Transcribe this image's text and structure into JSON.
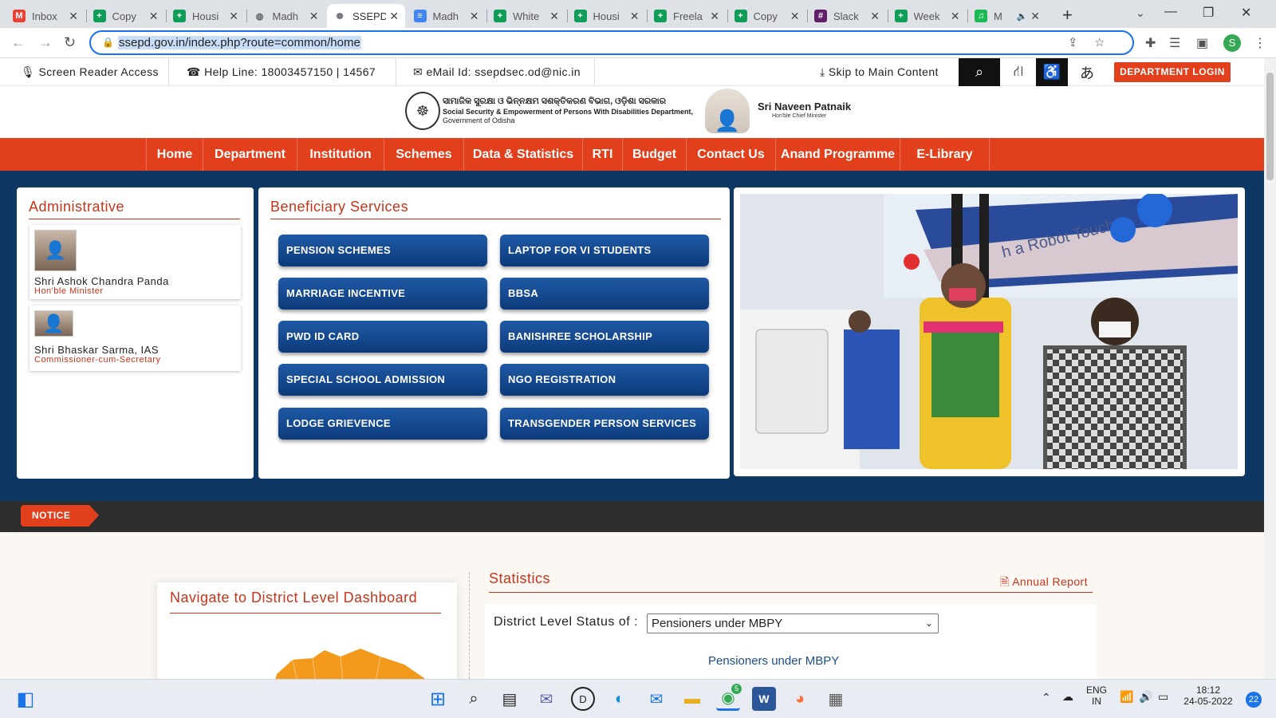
{
  "browser": {
    "tabs": [
      {
        "label": "Inbox",
        "icon": "gmail-icon",
        "color": "#ea4335",
        "glyph": "M"
      },
      {
        "label": "Copy",
        "icon": "sheets-icon",
        "color": "#0f9d58",
        "glyph": "+"
      },
      {
        "label": "Housi",
        "icon": "sheets-icon",
        "color": "#0f9d58",
        "glyph": "+"
      },
      {
        "label": "Madh",
        "icon": "globe-icon",
        "color": "#5f6368",
        "glyph": "◍"
      },
      {
        "label": "SSEPD",
        "icon": "odisha-emblem-icon",
        "color": "#5f6368",
        "glyph": "☸"
      },
      {
        "label": "Madh",
        "icon": "docs-icon",
        "color": "#4285f4",
        "glyph": "≡"
      },
      {
        "label": "White",
        "icon": "sheets-icon",
        "color": "#0f9d58",
        "glyph": "+"
      },
      {
        "label": "Housi",
        "icon": "sheets-icon",
        "color": "#0f9d58",
        "glyph": "+"
      },
      {
        "label": "Freela",
        "icon": "sheets-icon",
        "color": "#0f9d58",
        "glyph": "+"
      },
      {
        "label": "Copy",
        "icon": "sheets-icon",
        "color": "#0f9d58",
        "glyph": "+"
      },
      {
        "label": "Slack",
        "icon": "slack-icon",
        "color": "#611f69",
        "glyph": "#"
      },
      {
        "label": "Week",
        "icon": "sheets-icon",
        "color": "#0f9d58",
        "glyph": "+"
      },
      {
        "label": "M",
        "icon": "spotify-icon",
        "color": "#1db954",
        "glyph": "♫"
      }
    ],
    "active_tab": 4,
    "url": "ssepd.gov.in/index.php?route=common/home",
    "profile_initial": "S"
  },
  "util": {
    "screen_reader": "Screen Reader Access",
    "helpline": "Help Line: 18003457150 | 14567",
    "email": "eMail Id: ssepdsec.od@nic.in",
    "skip": "Skip to Main Content",
    "dept_login": "DEPARTMENT LOGIN"
  },
  "header": {
    "odia_title": "ସାମାଜିକ ସୁରକ୍ଷା ଓ ଭିନ୍ନକ୍ଷମ ସଶକ୍ତିକରଣ ବିଭାଗ, ଓଡ଼ିଶା ସରକାର",
    "dept_title": "Social Security & Empowerment of Persons With Disabilities Department,",
    "dept_sub": "Government of Odisha",
    "cm_name": "Sri Naveen Patnaik",
    "cm_role": "Hon'ble Chief Minister"
  },
  "nav": [
    "Home",
    "Department",
    "Institution",
    "Schemes",
    "Data & Statistics",
    "RTI",
    "Budget",
    "Contact Us",
    "Anand Programme",
    "E-Library"
  ],
  "administrative": {
    "title": "Administrative",
    "people": [
      {
        "name": "Shri Ashok Chandra Panda",
        "role": "Hon'ble Minister"
      },
      {
        "name": "Shri Bhaskar Sarma, IAS",
        "role": "Commissioner-cum-Secretary"
      }
    ]
  },
  "beneficiary": {
    "title": "Beneficiary Services",
    "left": [
      "PENSION SCHEMES",
      "MARRIAGE INCENTIVE",
      "PWD ID CARD",
      "SPECIAL SCHOOL ADMISSION",
      "LODGE GRIEVENCE"
    ],
    "right": [
      "LAPTOP FOR VI STUDENTS",
      "BBSA",
      "BANISHREE SCHOLARSHIP",
      "NGO REGISTRATION",
      "TRANSGENDER PERSON SERVICES"
    ]
  },
  "banner": {
    "sign_text": "h a Robot Touch"
  },
  "notice": {
    "label": "NOTICE"
  },
  "district": {
    "title": "Navigate to District Level Dashboard"
  },
  "stats": {
    "title": "Statistics",
    "annual_report": "Annual Report",
    "status_label": "District Level Status of :",
    "selected": "Pensioners under MBPY",
    "chart_title": "Pensioners under MBPY"
  },
  "taskbar": {
    "lang_top": "ENG",
    "lang_bottom": "IN",
    "time": "18:12",
    "date": "24-05-2022",
    "notifications": "22",
    "chrome_badge": "5"
  },
  "colors": {
    "accent": "#e2401c",
    "navy": "#0e3764",
    "button_blue": "#0c3a7a"
  }
}
